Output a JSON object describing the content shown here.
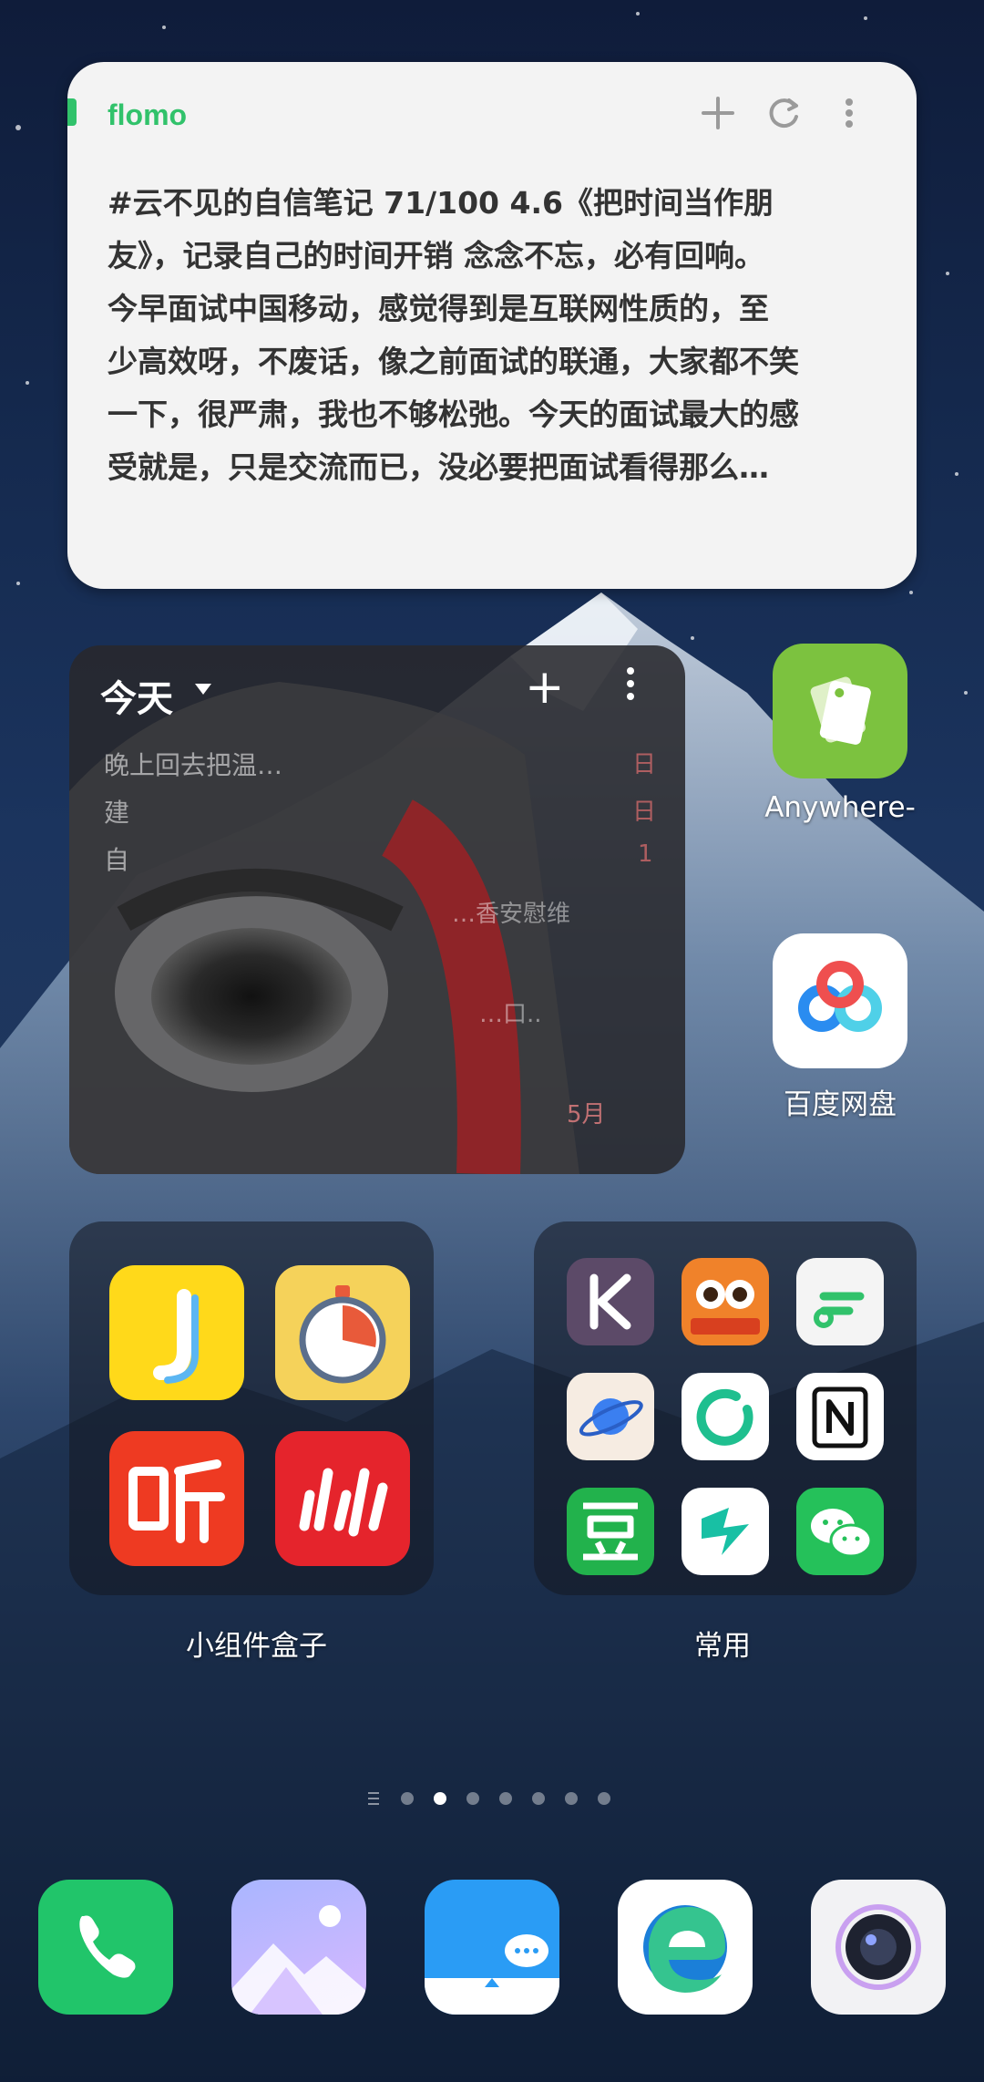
{
  "flomo": {
    "brand": "flomo",
    "add_icon": "plus-icon",
    "refresh_icon": "refresh-icon",
    "more_icon": "more-vertical-icon",
    "lines": [
      "#云不见的自信笔记 71/100 4.6《把时间当作朋",
      "友》，记录自己的时间开销 念念不忘，必有回响。",
      "今早面试中国移动，感觉得到是互联网性质的，至",
      "少高效呀，不废话，像之前面试的联通，大家都不笑",
      "一下，很严肃，我也不够松弛。今天的面试最大的感",
      "受就是，只是交流而已，没必要把面试看得那么…"
    ]
  },
  "today_widget": {
    "title": "今天",
    "rows": [
      "晚上回去把温…",
      "建",
      "自",
      "…香安慰维",
      "…口..",
      "5月"
    ],
    "right_marks": [
      "日",
      "日",
      "1"
    ]
  },
  "side_apps": [
    {
      "label": "Anywhere-",
      "icon": "anywhere-cards-icon",
      "color": "#7cc23f"
    },
    {
      "label": "百度网盘",
      "icon": "baidu-netdisk-icon",
      "color": "#ffffff"
    }
  ],
  "folders": [
    {
      "label": "小组件盒子",
      "apps": [
        "j-app-icon",
        "stopwatch-icon",
        "ting-listen-icon",
        "iqiyi-video-icon"
      ]
    },
    {
      "label": "常用",
      "apps": [
        "keep-icon",
        "owl-app-icon",
        "flomo-app-icon",
        "planet-browser-icon",
        "loop-app-icon",
        "notion-icon",
        "douban-icon",
        "lightning-app-icon",
        "wechat-icon"
      ]
    }
  ],
  "dock": [
    "phone-icon",
    "gallery-icon",
    "messages-icon",
    "edge-browser-icon",
    "camera-icon"
  ],
  "page_indicator": {
    "pages": 7,
    "active": 2
  }
}
